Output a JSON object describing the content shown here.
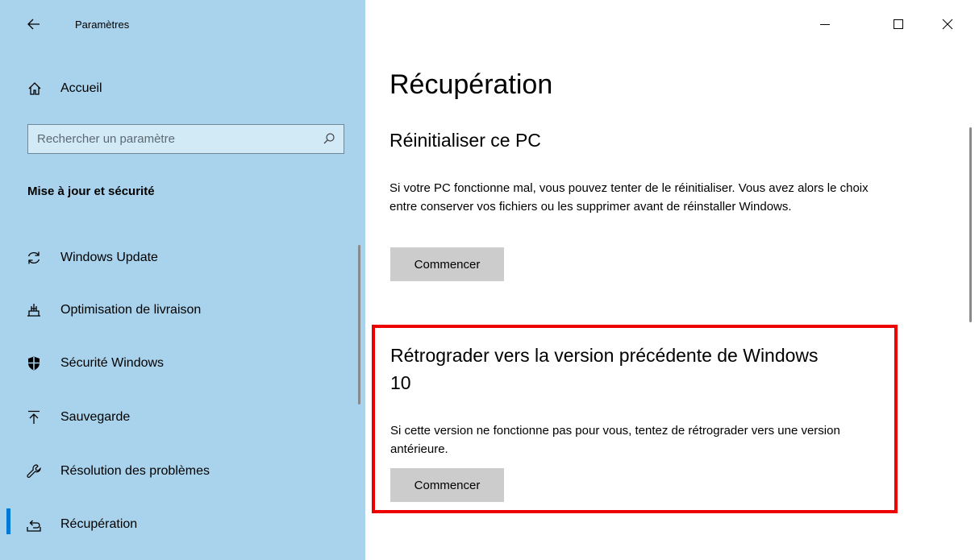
{
  "window": {
    "title": "Paramètres",
    "controls": {
      "minimize_icon": "minimize-icon",
      "maximize_icon": "maximize-icon",
      "close_icon": "close-icon"
    }
  },
  "sidebar": {
    "home_label": "Accueil",
    "search_placeholder": "Rechercher un paramètre",
    "section_title": "Mise à jour et sécurité",
    "items": [
      {
        "label": "Windows Update",
        "icon": "sync-icon",
        "selected": false
      },
      {
        "label": "Optimisation de livraison",
        "icon": "delivery-optimization-icon",
        "selected": false
      },
      {
        "label": "Sécurité Windows",
        "icon": "shield-icon",
        "selected": false
      },
      {
        "label": "Sauvegarde",
        "icon": "backup-arrow-icon",
        "selected": false
      },
      {
        "label": "Résolution des problèmes",
        "icon": "wrench-icon",
        "selected": false
      },
      {
        "label": "Récupération",
        "icon": "recovery-icon",
        "selected": true
      }
    ]
  },
  "main": {
    "page_title": "Récupération",
    "reset": {
      "heading": "Réinitialiser ce PC",
      "description": "Si votre PC fonctionne mal, vous pouvez tenter de le réinitialiser. Vous avez alors le choix entre conserver vos fichiers ou les supprimer avant de réinstaller Windows.",
      "button": "Commencer"
    },
    "rollback": {
      "heading": "Rétrograder vers la version précédente de Windows 10",
      "description": "Si cette version ne fonctionne pas pour vous, tentez de rétrograder vers une version antérieure.",
      "button": "Commencer"
    }
  },
  "colors": {
    "sidebar_bg": "#a9d3ec",
    "accent": "#0078d7",
    "highlight": "#ee0000",
    "button_bg": "#cccccc"
  }
}
